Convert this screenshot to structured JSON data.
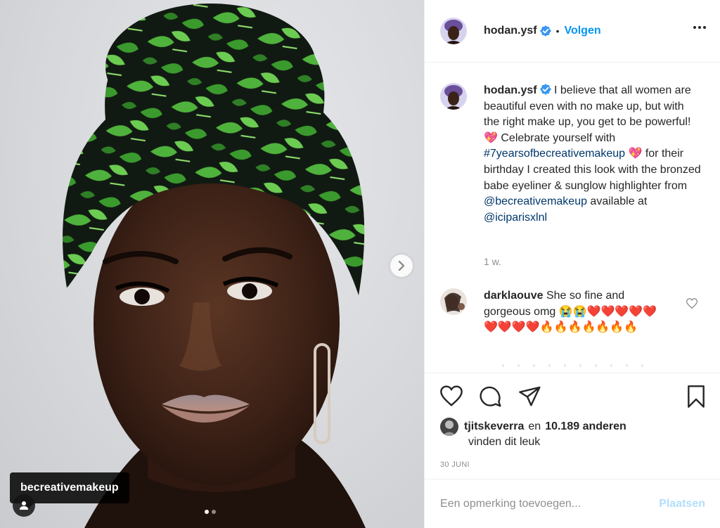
{
  "media": {
    "tag_label": "becreativemakeup",
    "slide_count": 2,
    "active_slide": 1
  },
  "header": {
    "username": "hodan.ysf",
    "separator": "•",
    "follow_label": "Volgen"
  },
  "caption": {
    "username": "hodan.ysf",
    "text_1": "I believe that all women are beautiful even with no make up, but with the right make up, you get to be powerful! 💖 Celebrate yourself with ",
    "hashtag": "#7yearsofbecreativemakeup",
    "text_2": " 💖 for their birthday I created this look with the bronzed babe eyeliner & sunglow highlighter from ",
    "mention_1": "@becreativemakeup",
    "text_3": " available at ",
    "mention_2": "@iciparisxlnl",
    "time_ago": "1 w."
  },
  "comments": [
    {
      "username": "darklaouve",
      "text": "She so fine and gorgeous omg 😭😭❤️❤️❤️❤️❤️❤️❤️❤️❤️🔥🔥🔥🔥🔥🔥🔥"
    }
  ],
  "likes": {
    "liker": "tjitskeverra",
    "conjunction": "en",
    "count": "10.189 anderen",
    "suffix": "vinden dit leuk"
  },
  "date": "30 JUNI",
  "add_comment": {
    "placeholder": "Een opmerking toevoegen...",
    "post_label": "Plaatsen"
  },
  "icons": {
    "verified": "verified-badge-icon",
    "more": "more-options-icon",
    "next": "chevron-right-icon",
    "like": "heart-icon",
    "comment": "comment-bubble-icon",
    "share": "paper-plane-icon",
    "save": "bookmark-icon",
    "tag_user": "user-tag-icon"
  },
  "colors": {
    "accent": "#0095f6",
    "link": "#00376b",
    "muted": "#8e8e8e",
    "post_disabled": "#b2dffc"
  }
}
